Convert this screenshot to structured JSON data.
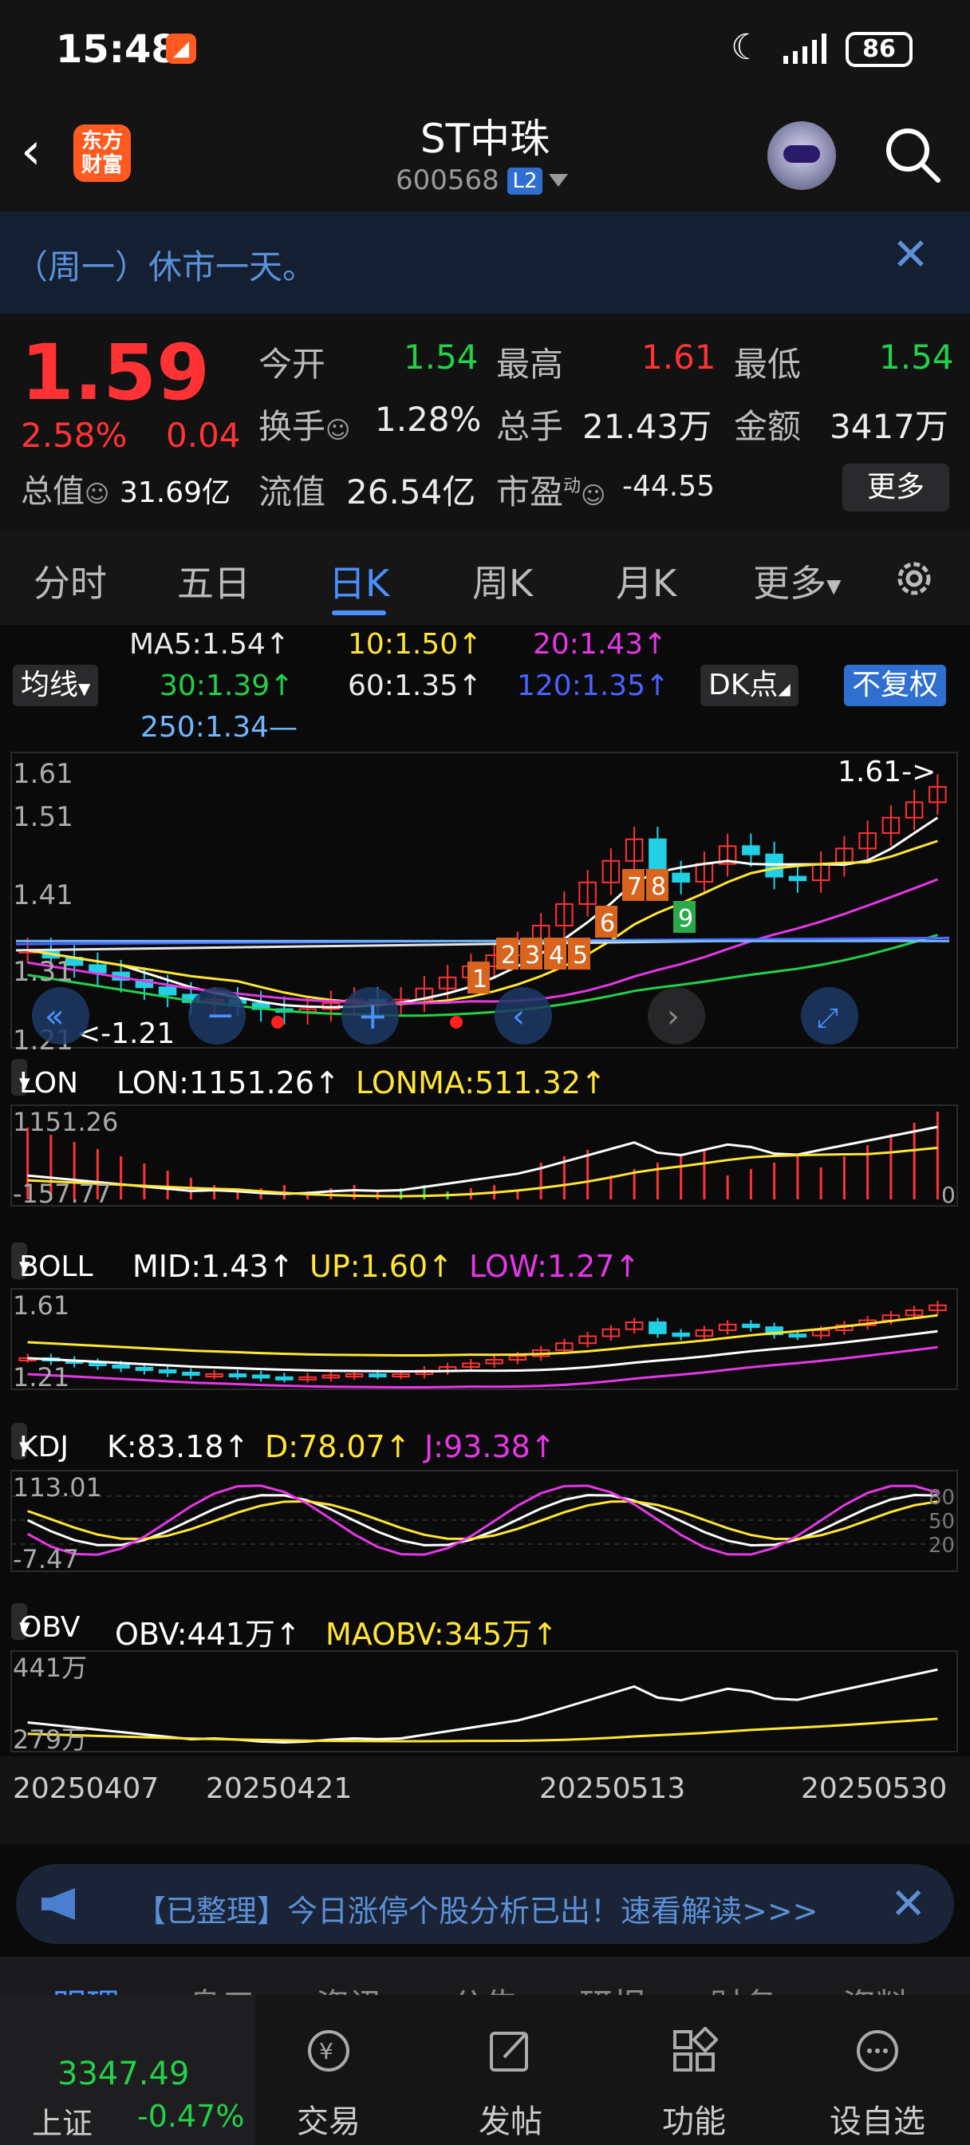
{
  "status_bar": {
    "time": "15:48",
    "battery": "86"
  },
  "header": {
    "logo_line1": "东方",
    "logo_line2": "财富",
    "stock_name": "ST中珠",
    "stock_code": "600568",
    "level_badge": "L2"
  },
  "notice": {
    "text": "（周一）休市一天。"
  },
  "quote": {
    "price": "1.59",
    "change_pct": "2.58%",
    "change": "0.04",
    "market_value_label": "总值",
    "market_value": "31.69亿",
    "open_label": "今开",
    "open": "1.54",
    "high_label": "最高",
    "high": "1.61",
    "low_label": "最低",
    "low": "1.54",
    "turnover_label": "换手",
    "turnover": "1.28%",
    "volume_label": "总手",
    "volume": "21.43万",
    "amount_label": "金额",
    "amount": "3417万",
    "float_label": "流值",
    "float_value": "26.54亿",
    "pe_label": "市盈",
    "pe_sup": "动",
    "pe": "-44.55",
    "more_label": "更多"
  },
  "tabs": [
    "分时",
    "五日",
    "日K",
    "周K",
    "月K",
    "更多"
  ],
  "active_tab": "日K",
  "ma_legend": {
    "ma_btn": "均线",
    "ma5": "MA5:1.54↑",
    "ma10": "10:1.50↑",
    "ma20": "20:1.43↑",
    "ma30": "30:1.39↑",
    "ma60": "60:1.35↑",
    "ma120": "120:1.35↑",
    "ma250": "250:1.34—",
    "dk_btn": "DK点",
    "fq_btn": "不复权"
  },
  "colors": {
    "up": "#ff3333",
    "down": "#22d0e6",
    "ma5": "#ffffff",
    "ma10": "#ffe535",
    "ma20": "#e637e6",
    "ma30": "#22d14a",
    "ma60": "#e6e6e6",
    "ma120": "#4a63ff",
    "ma250": "#6fb8ff"
  },
  "main_chart": {
    "y_labels": [
      "1.61",
      "1.51",
      "1.41",
      "1.31",
      "1.21"
    ],
    "max_label": "1.61->",
    "min_label": "<-1.21",
    "markers": [
      "1",
      "2",
      "3",
      "4",
      "5",
      "6",
      "7",
      "8",
      "9"
    ]
  },
  "lon": {
    "btn": "LON",
    "lon": "LON:1151.26↑",
    "lonma": "LONMA:511.32↑",
    "y_top": "1151.26",
    "y_bottom": "-157.77",
    "zero": "0"
  },
  "boll": {
    "btn": "BOLL",
    "mid": "MID:1.43↑",
    "up": "UP:1.60↑",
    "low": "LOW:1.27↑",
    "y_top": "1.61",
    "y_bottom": "1.21"
  },
  "kdj": {
    "btn": "KDJ",
    "k": "K:83.18↑",
    "d": "D:78.07↑",
    "j": "J:93.38↑",
    "y_top": "113.01",
    "y_bottom": "-7.47",
    "levels": [
      "80",
      "50",
      "20"
    ]
  },
  "obv": {
    "btn": "OBV",
    "obv": "OBV:441万↑",
    "maobv": "MAOBV:345万↑",
    "y_top": "441万",
    "y_bottom": "279万"
  },
  "dates": [
    "20250407",
    "20250421",
    "20250513",
    "20250530"
  ],
  "banner": {
    "text": "【已整理】今日涨停个股分析已出！速看解读>>>"
  },
  "bottom_tabs": [
    "明理",
    "息口",
    "资讯",
    "公告",
    "研报",
    "财务",
    "资料"
  ],
  "index": {
    "value": "3347.49",
    "name": "上证",
    "pct": "-0.47%"
  },
  "nav": [
    {
      "label": "交易",
      "icon": "trade-icon"
    },
    {
      "label": "发帖",
      "icon": "post-icon"
    },
    {
      "label": "功能",
      "icon": "function-icon"
    },
    {
      "label": "设自选",
      "icon": "watchlist-icon"
    }
  ]
}
